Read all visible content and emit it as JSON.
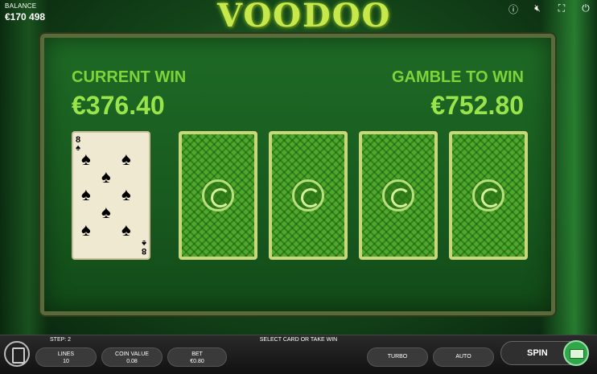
{
  "balance": {
    "label": "BALANCE",
    "value": "€170 498"
  },
  "logo": {
    "text": "VOODOO"
  },
  "top_icons": [
    "info-icon",
    "sound-mute-icon",
    "fullscreen-icon",
    "power-icon"
  ],
  "current_win": {
    "label": "CURRENT WIN",
    "value": "€376.40"
  },
  "gamble_to_win": {
    "label": "GAMBLE TO WIN",
    "value": "€752.80"
  },
  "dealer_card": {
    "rank": "8",
    "suit": "♠"
  },
  "hidden_cards": [
    "card-back",
    "card-back",
    "card-back",
    "card-back"
  ],
  "bottom": {
    "step": "STEP: 2",
    "message": "SELECT CARD OR TAKE WIN",
    "lines": {
      "label": "LINES",
      "value": "10"
    },
    "coin_value": {
      "label": "COIN VALUE",
      "value": "0.08"
    },
    "bet": {
      "label": "BET",
      "value": "€0.80"
    },
    "turbo": "TURBO",
    "auto": "AUTO",
    "spin": "SPIN"
  },
  "colors": {
    "accent_green": "#98e44a",
    "board_green": "#1e6a25",
    "card_back": "#4fa82c"
  }
}
